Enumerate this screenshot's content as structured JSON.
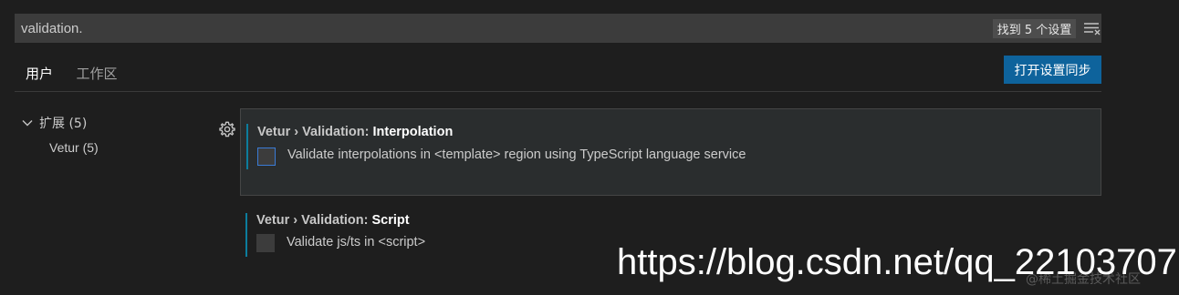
{
  "search": {
    "value": "validation.",
    "result_badge": "找到 5 个设置",
    "filter_icon": "clear-filter-icon"
  },
  "tabs": [
    {
      "label": "用户",
      "active": true
    },
    {
      "label": "工作区",
      "active": false
    }
  ],
  "sync_button_label": "打开设置同步",
  "toc": {
    "group_label": "扩展 (5)",
    "items": [
      {
        "label": "Vetur (5)"
      }
    ]
  },
  "settings": [
    {
      "category": "Vetur › Validation: ",
      "name": "Interpolation",
      "description": "Validate interpolations in <template> region using TypeScript language service",
      "checked": false,
      "focused": true
    },
    {
      "category": "Vetur › Validation: ",
      "name": "Script",
      "description": "Validate js/ts in <script>",
      "checked": false,
      "focused": false
    }
  ],
  "watermark": {
    "url": "https://blog.csdn.net/qq_22103707",
    "sub": "@稀土掘金技术社区"
  },
  "colors": {
    "background": "#1e1e1e",
    "input_background": "#3c3c3c",
    "accent_button": "#0e639c",
    "modified_bar": "#0c7d9d"
  }
}
